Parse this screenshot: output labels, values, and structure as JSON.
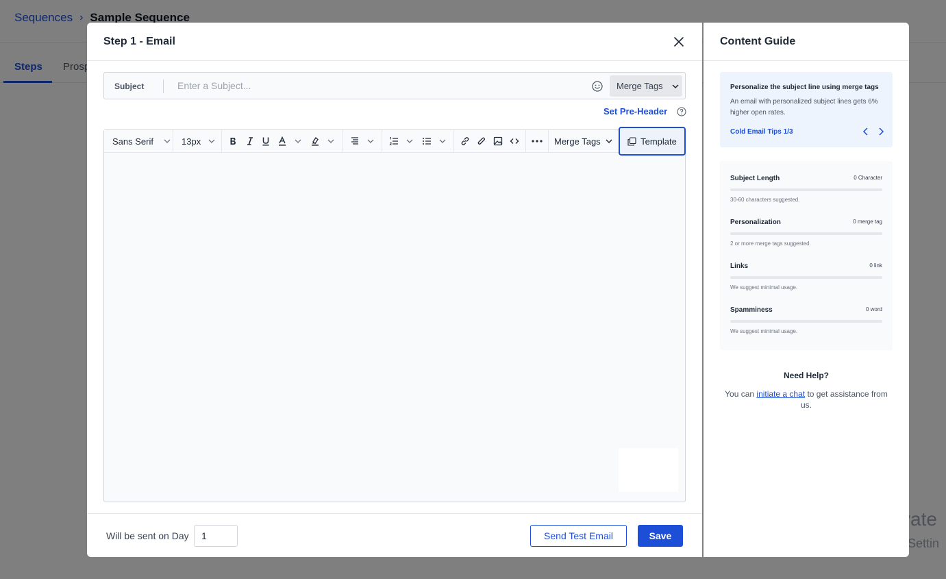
{
  "background": {
    "breadcrumb": {
      "parent": "Sequences",
      "separator": "›",
      "current": "Sample Sequence"
    },
    "tabs": {
      "active": "Steps",
      "second": "Prosp"
    },
    "watermark": {
      "line1": "vate",
      "line2": "Settin"
    }
  },
  "modal": {
    "title": "Step 1 - Email",
    "subject": {
      "label": "Subject",
      "placeholder": "Enter a Subject...",
      "value": "",
      "merge_tags_label": "Merge Tags"
    },
    "preheader_label": "Set Pre-Header",
    "toolbar": {
      "font_family": "Sans Serif",
      "font_size": "13px",
      "merge_tags_label": "Merge Tags",
      "template_label": "Template"
    },
    "footer": {
      "day_label": "Will be sent on Day",
      "day_value": "1",
      "send_test_label": "Send Test Email",
      "save_label": "Save"
    }
  },
  "guide": {
    "title": "Content Guide",
    "tip": {
      "title": "Personalize the subject line using merge tags",
      "text": "An email with personalized subject lines gets 6% higher open rates.",
      "link": "Cold Email Tips 1/3"
    },
    "metrics": [
      {
        "name": "Subject Length",
        "value": "0 Character",
        "hint": "30-60 characters suggested.",
        "fill": 0
      },
      {
        "name": "Personalization",
        "value": "0 merge tag",
        "hint": "2 or more merge tags suggested.",
        "fill": 0
      },
      {
        "name": "Links",
        "value": "0 link",
        "hint": "We suggest minimal usage.",
        "fill": 0
      },
      {
        "name": "Spamminess",
        "value": "0 word",
        "hint": "We suggest minimal usage.",
        "fill": 0
      }
    ],
    "help": {
      "title": "Need Help?",
      "text_before": "You can ",
      "link": "initiate a chat",
      "text_after": " to get assistance from us."
    }
  },
  "colors": {
    "accent": "#1d4ed8",
    "overlay": "rgba(0,0,0,0.5)"
  }
}
